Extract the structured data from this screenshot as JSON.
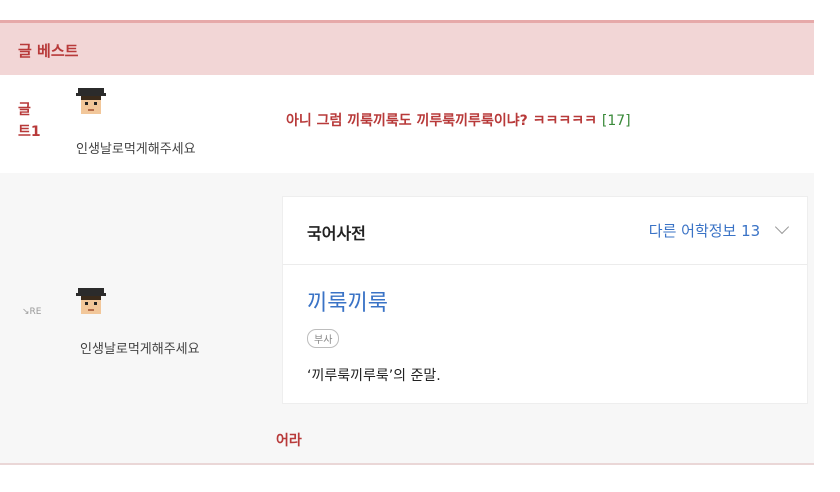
{
  "board": {
    "title": "글 베스트"
  },
  "post": {
    "label": "글\n트1",
    "nickname": "인생날로먹게해주세요",
    "title": "아니 그럼 끼룩끼룩도 끼루룩끼루룩이냐? ㅋㅋㅋㅋㅋ",
    "comment_count": "[17]"
  },
  "reply": {
    "icon_text": "RE",
    "nickname": "인생날로먹게해주세요",
    "text": "어라"
  },
  "dictionary": {
    "title": "국어사전",
    "more_label": "다른 어학정보 13",
    "word": "끼룩끼룩",
    "part_of_speech": "부사",
    "definition": "‘끼루룩끼루룩’의 준말."
  },
  "icons": {
    "avatar": "pixel-avatar-icon",
    "chevron": "chevron-down-icon",
    "reply": "reply-arrow-icon"
  },
  "colors": {
    "board_red": "#b83a3a",
    "link_blue": "#3a73c6",
    "count_green": "#3a8a3a",
    "header_pink": "#f2d6d6"
  }
}
